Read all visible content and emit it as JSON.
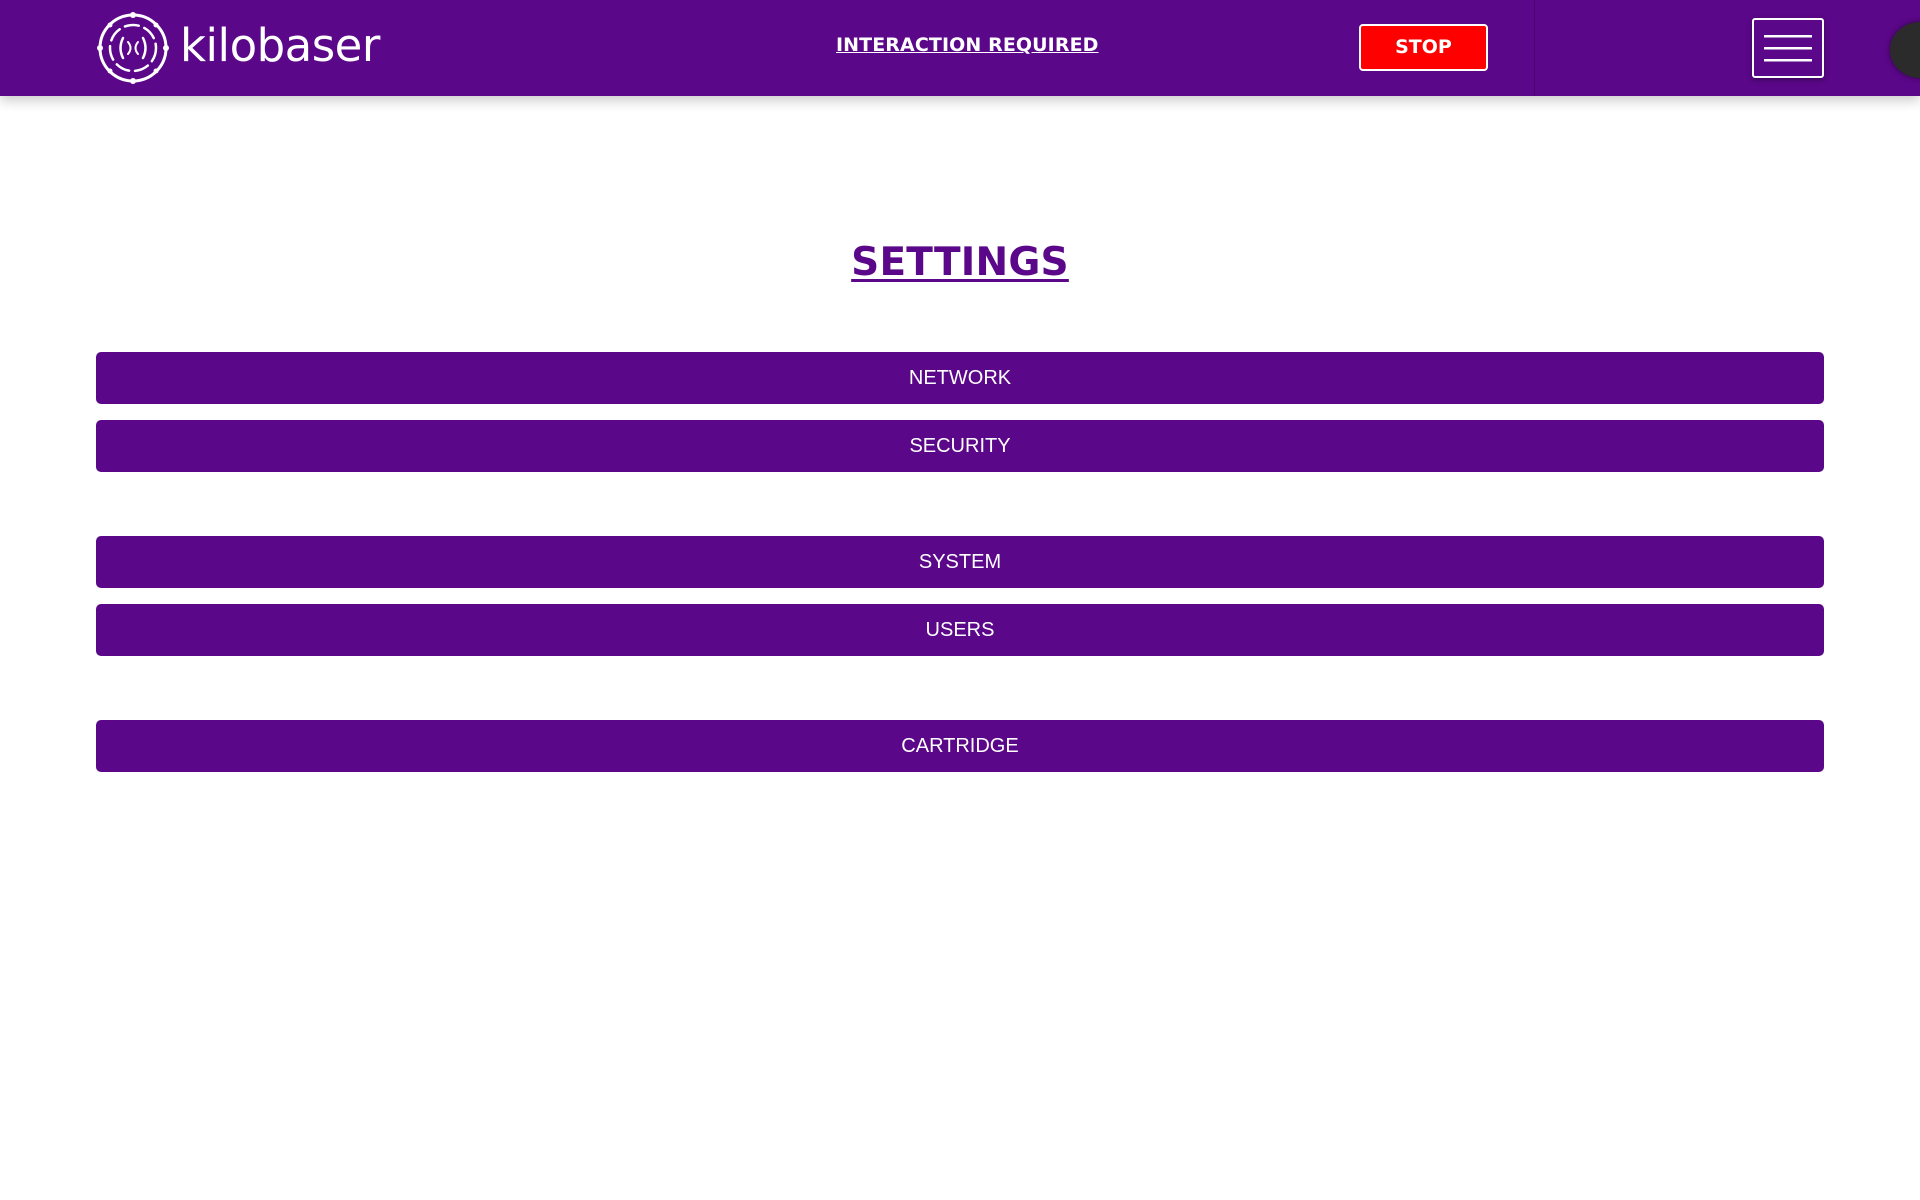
{
  "header": {
    "brand_name": "kilobaser",
    "interaction_label": "INTERACTION REQUIRED",
    "stop_label": "STOP",
    "menu_icon": "hamburger-menu-icon",
    "logo_icon": "kilobaser-logo-icon"
  },
  "main": {
    "title": "SETTINGS",
    "buttons": [
      {
        "label": "NETWORK"
      },
      {
        "label": "SECURITY"
      },
      {
        "label": "SYSTEM"
      },
      {
        "label": "USERS"
      },
      {
        "label": "CARTRIDGE"
      }
    ]
  },
  "colors": {
    "brand_purple": "#5b0789",
    "stop_red": "#ff0000",
    "background": "#ffffff",
    "text_light": "#ffffff"
  }
}
